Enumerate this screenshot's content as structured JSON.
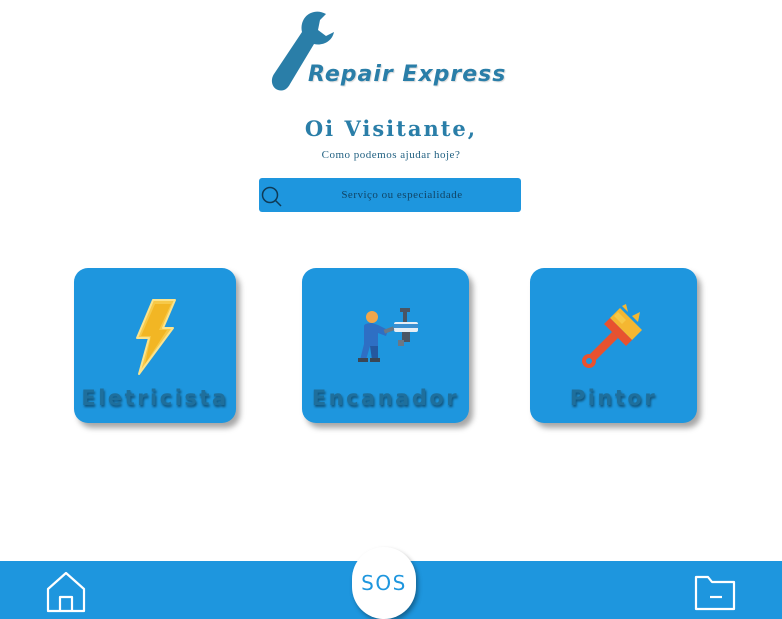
{
  "brand": {
    "name": "Repair Express",
    "logo_icon": "wrench-icon",
    "color": "#2a7ea8"
  },
  "greeting": {
    "title": "Oi Visitante,",
    "subtitle": "Como podemos ajudar hoje?"
  },
  "search": {
    "placeholder": "Serviço ou especialidade",
    "icon": "search-icon"
  },
  "services": [
    {
      "label": "Eletricista",
      "icon": "lightning-icon"
    },
    {
      "label": "Encanador",
      "icon": "plumber-icon"
    },
    {
      "label": "Pintor",
      "icon": "paintbrush-icon"
    }
  ],
  "bottom_nav": {
    "home_icon": "home-icon",
    "sos_label": "SOS",
    "folder_icon": "folder-icon"
  },
  "colors": {
    "accent": "#1e96de",
    "text_dark": "#1f6f9c",
    "background": "#ffffff"
  }
}
